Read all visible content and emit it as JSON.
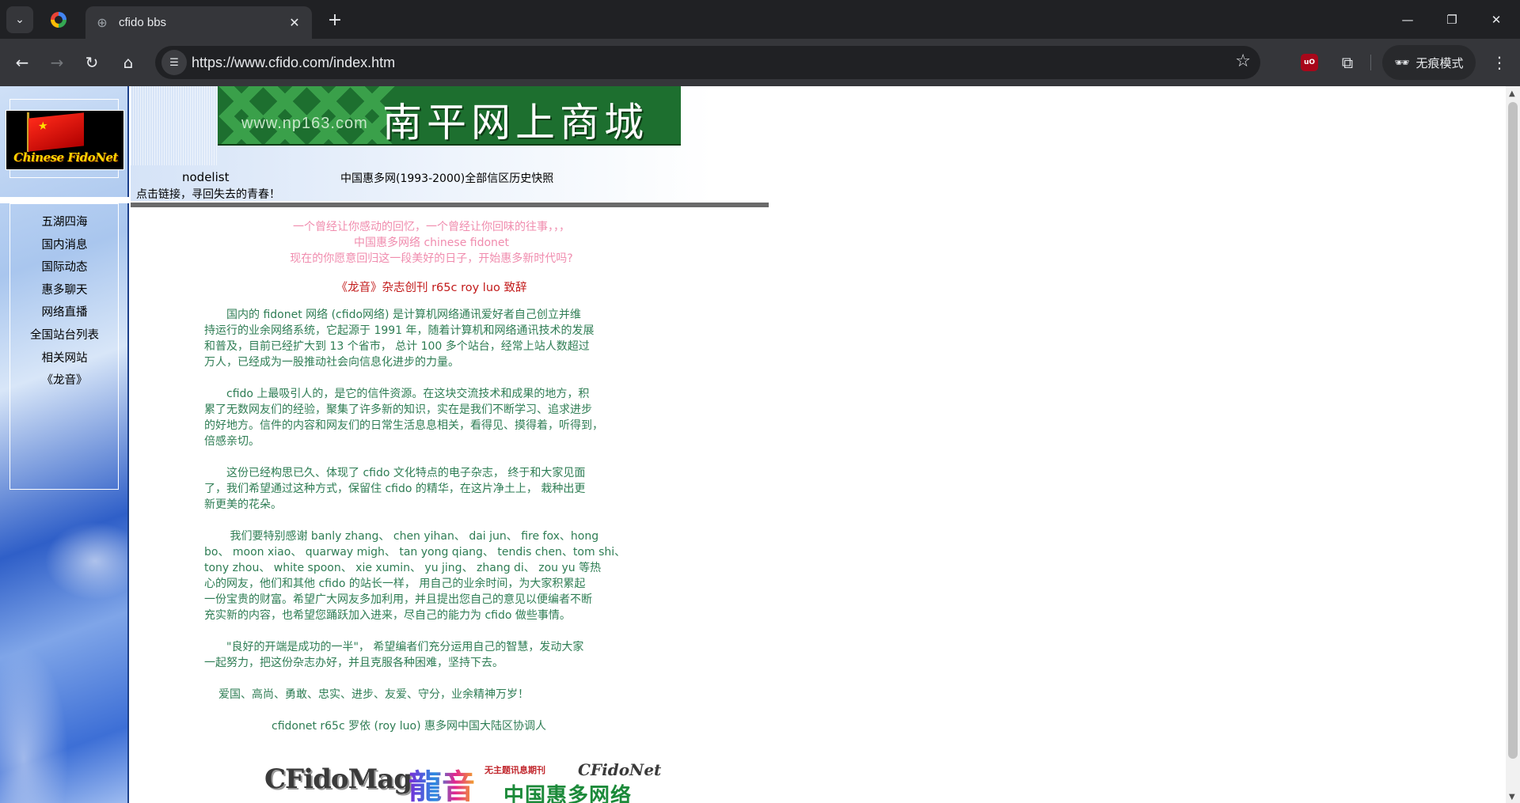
{
  "browser": {
    "tab_title": "cfido bbs",
    "url": "https://www.cfido.com/index.htm",
    "incognito_label": "无痕模式",
    "ublock_label": "uO"
  },
  "sidebar": {
    "logo_text": "Chinese FidoNet",
    "menu": [
      "五湖四海",
      "国内消息",
      "国际动态",
      "惠多聊天",
      "网络直播",
      "全国站台列表",
      "相关网站",
      "《龙音》"
    ]
  },
  "banner": {
    "url_text": "www.np163.com",
    "title": "南平网上商城"
  },
  "links": {
    "nodelist": "nodelist",
    "history": "中国惠多网(1993-2000)全部信区历史快照",
    "tagline": "点击链接，寻回失去的青春！"
  },
  "article": {
    "intro": [
      "一个曾经让你感动的回忆，一个曾经让你回味的往事，，，",
      "中国惠多网络 chinese fidonet",
      "现在的你愿意回归这一段美好的日子，开始惠多新时代吗?"
    ],
    "headline": "《龙音》杂志创刊    r65c roy luo 致辞",
    "paragraphs": [
      [
        "　　国内的 fidonet 网络 (cfido网络) 是计算机网络通讯爱好者自己创立并维",
        "持运行的业余网络系统，它起源于 1991 年，随着计算机和网络通讯技术的发展",
        "和普及，目前已经扩大到 13 个省市， 总计 100 多个站台，经常上站人数超过",
        "万人，已经成为一股推动社会向信息化进步的力量。"
      ],
      [
        "　　cfido 上最吸引人的，是它的信件资源。在这块交流技术和成果的地方，积",
        "累了无数网友们的经验，聚集了许多新的知识，实在是我们不断学习、追求进步",
        "的好地方。信件的内容和网友们的日常生活息息相关，看得见、摸得着，听得到，",
        "倍感亲切。"
      ],
      [
        "　　这份已经构思已久、体现了 cfido 文化特点的电子杂志， 终于和大家见面",
        "了，我们希望通过这种方式，保留住 cfido 的精华，在这片净土上， 栽种出更",
        "新更美的花朵。"
      ],
      [
        "　　 我们要特别感谢 banly zhang、 chen yihan、 dai jun、 fire fox、hong",
        "bo、 moon xiao、 quarway migh、 tan yong qiang、 tendis chen、tom shi、",
        "tony zhou、 white spoon、 xie xumin、 yu jing、 zhang di、 zou yu 等热",
        "心的网友，他们和其他 cfido 的站长一样， 用自己的业余时间，为大家积累起",
        "一份宝贵的财富。希望广大网友多加利用，并且提出您自己的意见以便编者不断",
        "充实新的内容，也希望您踊跃加入进来，尽自己的能力为 cfido 做些事情。"
      ],
      [
        "　　\"良好的开端是成功的一半\"， 希望编者们充分运用自己的智慧，发动大家",
        "一起努力，把这份杂志办好，并且克服各种困难，坚持下去。"
      ]
    ],
    "motto": "爱国、高尚、勇敢、忠实、进步、友爱、守分，业余精神万岁！",
    "signature": "cfidonet r65c 罗依 (roy luo) 惠多网中国大陆区协调人"
  },
  "footer_logo": {
    "cfidomag": "CFidoMag",
    "longyin": "龍音",
    "pub_text": "无主题讯息期刊",
    "cfidonet": "CFidoNet",
    "cn_name": "中国惠多网络"
  }
}
